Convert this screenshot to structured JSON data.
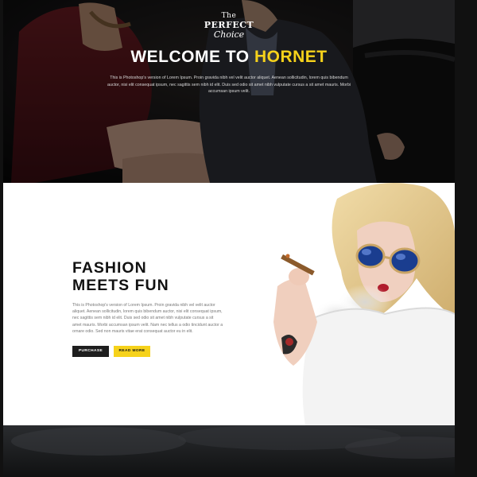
{
  "hero": {
    "logo_line1": "The",
    "logo_line2": "PERFECT",
    "logo_line3": "Choice",
    "title_prefix": "WELCOME TO ",
    "title_accent": "HORNET",
    "body": "This is Photoshop's version of Lorem Ipsum. Proin gravida nibh vel velit auctor aliquet. Aenean sollicitudin, lorem quis bibendum auctor, nisi elit consequat ipsum, nec sagittis sem nibh id elit. Duis sed odio sit amet nibh vulputate cursus a sit amet mauris. Morbi accumsan ipsum velit."
  },
  "fashion": {
    "title_line1": "FASHION",
    "title_line2": "MEETS FUN",
    "body": "This is Photoshop's version of Lorem Ipsum. Proin gravida nibh vel velit auctor aliquet. Aenean sollicitudin, lorem quis bibendum auctor, nisi elit consequat ipsum, nec sagittis sem nibh id elit. Duis sed odio sit amet nibh vulputate cursus a sit amet mauris. Morbi accumsan ipsum velit. Nam nec tellus a odio tincidunt auctor a ornare odio. Sed non mauris vitae erat consequat auctor eu in elit.",
    "purchase_label": "PURCHASE",
    "readmore_label": "READ MORE"
  },
  "colors": {
    "accent": "#f6d21b",
    "dark_button": "#1e1e1e",
    "hero_bg": "#0e0e10"
  },
  "icons": {
    "logo": "the-perfect-choice-logo"
  }
}
